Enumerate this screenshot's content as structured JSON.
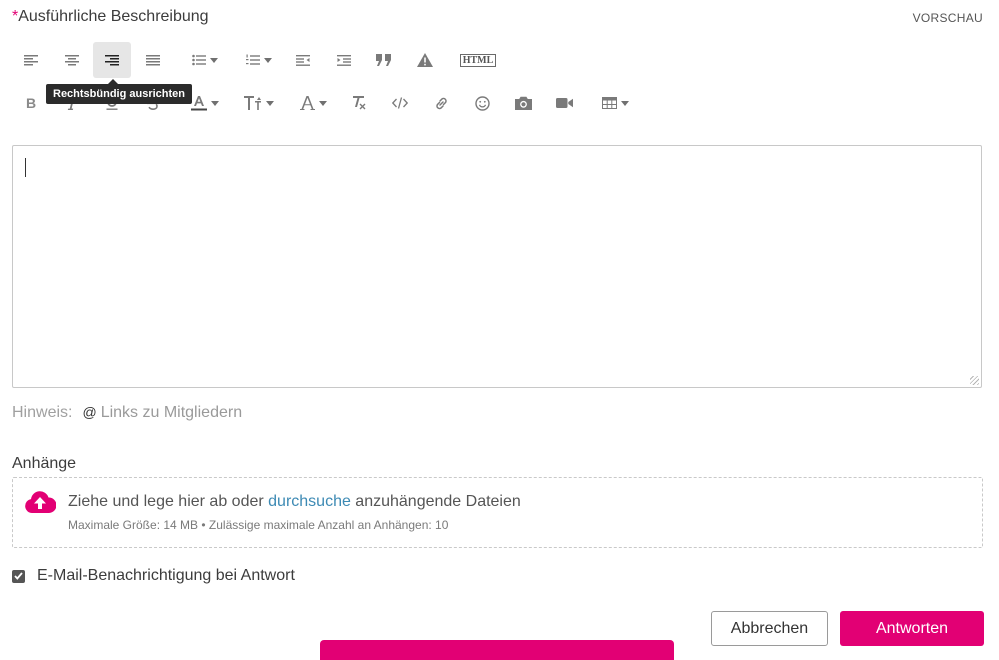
{
  "header": {
    "required_mark": "*",
    "label": "Ausführliche Beschreibung",
    "preview": "VORSCHAU"
  },
  "toolbar": {
    "row1": [
      "align-left-icon",
      "align-center-icon",
      "align-right-icon",
      "align-justify-icon",
      "bullet-list-icon",
      "numbered-list-icon",
      "outdent-icon",
      "indent-icon",
      "quote-icon",
      "warning-icon",
      "html-icon"
    ],
    "row2": [
      "bold-icon",
      "italic-icon",
      "underline-icon",
      "strikethrough-icon",
      "font-color-icon",
      "font-size-icon",
      "font-family-icon",
      "clear-format-icon",
      "code-icon",
      "link-icon",
      "emoji-icon",
      "camera-icon",
      "video-icon",
      "table-icon"
    ],
    "html_label": "HTML",
    "bold_label": "B",
    "tooltip": "Rechtsbündig ausrichten",
    "active": "align-right-icon"
  },
  "editor": {
    "value": ""
  },
  "hint": {
    "label": "Hinweis:",
    "at": "@",
    "link": "Links zu Mitgliedern"
  },
  "attachments": {
    "label": "Anhänge",
    "text_before": "Ziehe und lege hier ab oder ",
    "browse": "durchsuche",
    "text_after": " anzuhängende Dateien",
    "limits": "Maximale Größe: 14 MB • Zulässige maximale Anzahl an Anhängen: 10"
  },
  "notify": {
    "label": "E-Mail-Benachrichtigung bei Antwort",
    "checked": true
  },
  "buttons": {
    "cancel": "Abbrechen",
    "reply": "Antworten"
  },
  "colors": {
    "brand": "#e20074",
    "link": "#3d8ab4"
  }
}
